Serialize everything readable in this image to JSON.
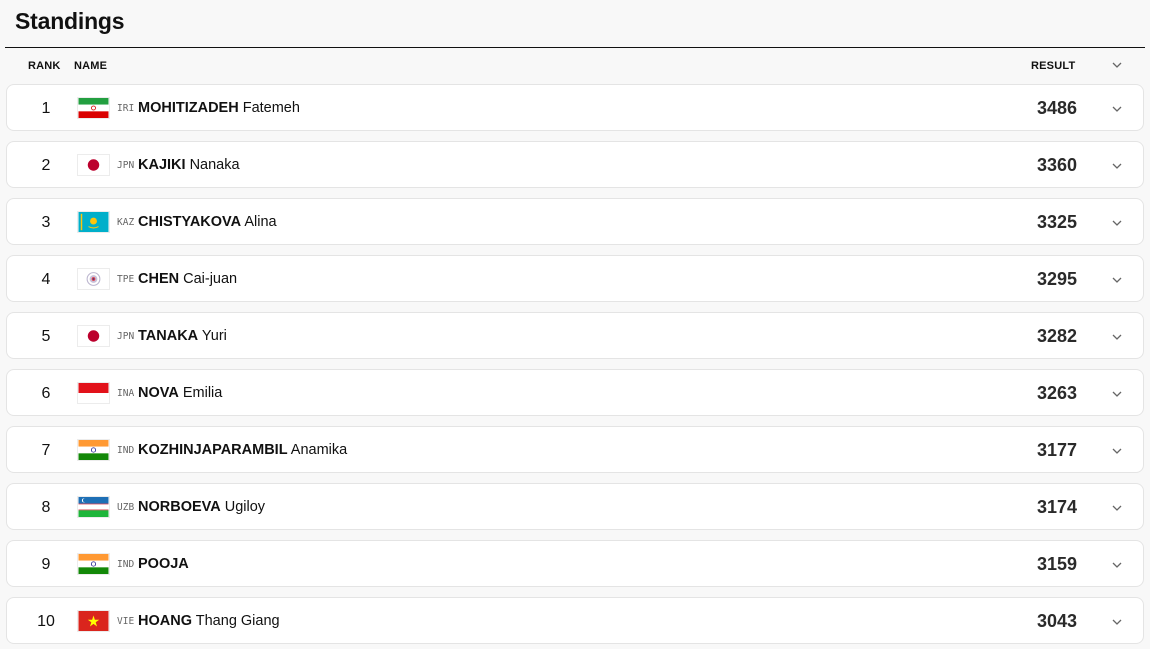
{
  "page": {
    "title": "Standings"
  },
  "columns": {
    "rank": "RANK",
    "name": "NAME",
    "result": "RESULT"
  },
  "colors": {
    "text": "#111111",
    "row_bg": "#ffffff",
    "page_bg": "#f8f8f8",
    "result_text": "#2a2a2a"
  },
  "rows": [
    {
      "rank": "1",
      "code": "IRI",
      "surname": "MOHITIZADEH",
      "given": "Fatemeh",
      "result": "3486",
      "flag_icon": "iran-flag-icon"
    },
    {
      "rank": "2",
      "code": "JPN",
      "surname": "KAJIKI",
      "given": "Nanaka",
      "result": "3360",
      "flag_icon": "japan-flag-icon"
    },
    {
      "rank": "3",
      "code": "KAZ",
      "surname": "CHISTYAKOVA",
      "given": "Alina",
      "result": "3325",
      "flag_icon": "kazakhstan-flag-icon"
    },
    {
      "rank": "4",
      "code": "TPE",
      "surname": "CHEN",
      "given": "Cai-juan",
      "result": "3295",
      "flag_icon": "chinese-taipei-flag-icon"
    },
    {
      "rank": "5",
      "code": "JPN",
      "surname": "TANAKA",
      "given": "Yuri",
      "result": "3282",
      "flag_icon": "japan-flag-icon"
    },
    {
      "rank": "6",
      "code": "INA",
      "surname": "NOVA",
      "given": "Emilia",
      "result": "3263",
      "flag_icon": "indonesia-flag-icon"
    },
    {
      "rank": "7",
      "code": "IND",
      "surname": "KOZHINJAPARAMBIL",
      "given": "Anamika",
      "result": "3177",
      "flag_icon": "india-flag-icon"
    },
    {
      "rank": "8",
      "code": "UZB",
      "surname": "NORBOEVA",
      "given": "Ugiloy",
      "result": "3174",
      "flag_icon": "uzbekistan-flag-icon"
    },
    {
      "rank": "9",
      "code": "IND",
      "surname": "POOJA",
      "given": "",
      "result": "3159",
      "flag_icon": "india-flag-icon"
    },
    {
      "rank": "10",
      "code": "VIE",
      "surname": "HOANG",
      "given": "Thang Giang",
      "result": "3043",
      "flag_icon": "vietnam-flag-icon"
    }
  ]
}
